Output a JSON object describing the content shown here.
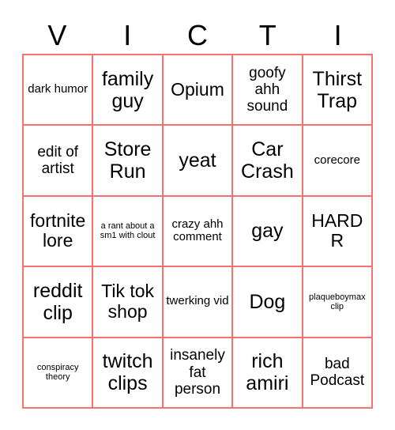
{
  "card": {
    "title_letters": [
      "V",
      "I",
      "C",
      "T",
      "I"
    ],
    "border_color": "#f87171",
    "background_color": "#ffffff",
    "text_color": "#000000",
    "rows": 5,
    "columns": 5,
    "cells": [
      {
        "text": "dark humor",
        "size": "sm"
      },
      {
        "text": "family guy",
        "size": "xl"
      },
      {
        "text": "Opium",
        "size": "lg"
      },
      {
        "text": "goofy ahh sound",
        "size": "md"
      },
      {
        "text": "Thirst Trap",
        "size": "xl"
      },
      {
        "text": "edit of artist",
        "size": "md"
      },
      {
        "text": "Store Run",
        "size": "xl"
      },
      {
        "text": "yeat",
        "size": "xl"
      },
      {
        "text": "Car Crash",
        "size": "xl"
      },
      {
        "text": "corecore",
        "size": "sm"
      },
      {
        "text": "fortnite lore",
        "size": "lg"
      },
      {
        "text": "a rant about a sm1 with clout",
        "size": "xs"
      },
      {
        "text": "crazy ahh comment",
        "size": "sm"
      },
      {
        "text": "gay",
        "size": "xl"
      },
      {
        "text": "HARD R",
        "size": "lg"
      },
      {
        "text": "reddit clip",
        "size": "xl"
      },
      {
        "text": "Tik tok shop",
        "size": "lg"
      },
      {
        "text": "twerking vid",
        "size": "sm"
      },
      {
        "text": "Dog",
        "size": "xl"
      },
      {
        "text": "plaqueboymax clip",
        "size": "xs"
      },
      {
        "text": "conspiracy theory",
        "size": "xs"
      },
      {
        "text": "twitch clips",
        "size": "xl"
      },
      {
        "text": "insanely fat person",
        "size": "md"
      },
      {
        "text": "rich amiri",
        "size": "xl"
      },
      {
        "text": "bad Podcast",
        "size": "md"
      }
    ]
  }
}
